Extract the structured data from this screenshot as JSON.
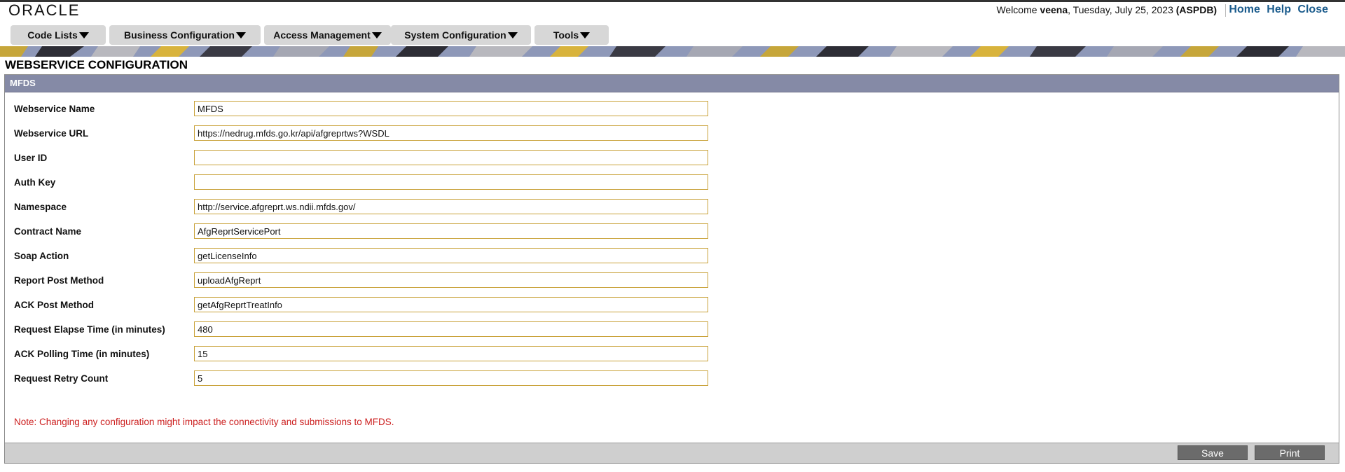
{
  "app": {
    "logo": "ORACLE",
    "welcome_prefix": "Welcome",
    "user": "veena",
    "date": ", Tuesday, July 25, 2023",
    "db": "(ASPDB)",
    "links": {
      "home": "Home",
      "help": "Help",
      "close": "Close"
    }
  },
  "menu": [
    {
      "label": "Code Lists"
    },
    {
      "label": "Business Configuration"
    },
    {
      "label": "Access Management"
    },
    {
      "label": "System Configuration"
    },
    {
      "label": "Tools"
    }
  ],
  "page": {
    "title": "WEBSERVICE CONFIGURATION",
    "section": "MFDS",
    "fields": [
      {
        "label": "Webservice Name",
        "value": "MFDS"
      },
      {
        "label": "Webservice URL",
        "value": "https://nedrug.mfds.go.kr/api/afgreprtws?WSDL"
      },
      {
        "label": "User ID",
        "value": ""
      },
      {
        "label": "Auth Key",
        "value": ""
      },
      {
        "label": "Namespace",
        "value": "http://service.afgreprt.ws.ndii.mfds.gov/"
      },
      {
        "label": "Contract Name",
        "value": "AfgReprtServicePort"
      },
      {
        "label": "Soap Action",
        "value": "getLicenseInfo"
      },
      {
        "label": "Report Post Method",
        "value": "uploadAfgReprt"
      },
      {
        "label": "ACK Post Method",
        "value": "getAfgReprtTreatInfo"
      },
      {
        "label": "Request Elapse Time (in minutes)",
        "value": "480"
      },
      {
        "label": "ACK Polling Time (in minutes)",
        "value": "15"
      },
      {
        "label": "Request Retry Count",
        "value": "5"
      }
    ],
    "note": "Note: Changing any configuration might impact the connectivity and submissions to MFDS.",
    "buttons": {
      "save": "Save",
      "print": "Print"
    }
  },
  "colors": {
    "link": "#1a5b8c",
    "panel_header": "#858aa6",
    "input_border": "#c9a23a",
    "note": "#cc1f1f",
    "button": "#6b6b6b"
  }
}
